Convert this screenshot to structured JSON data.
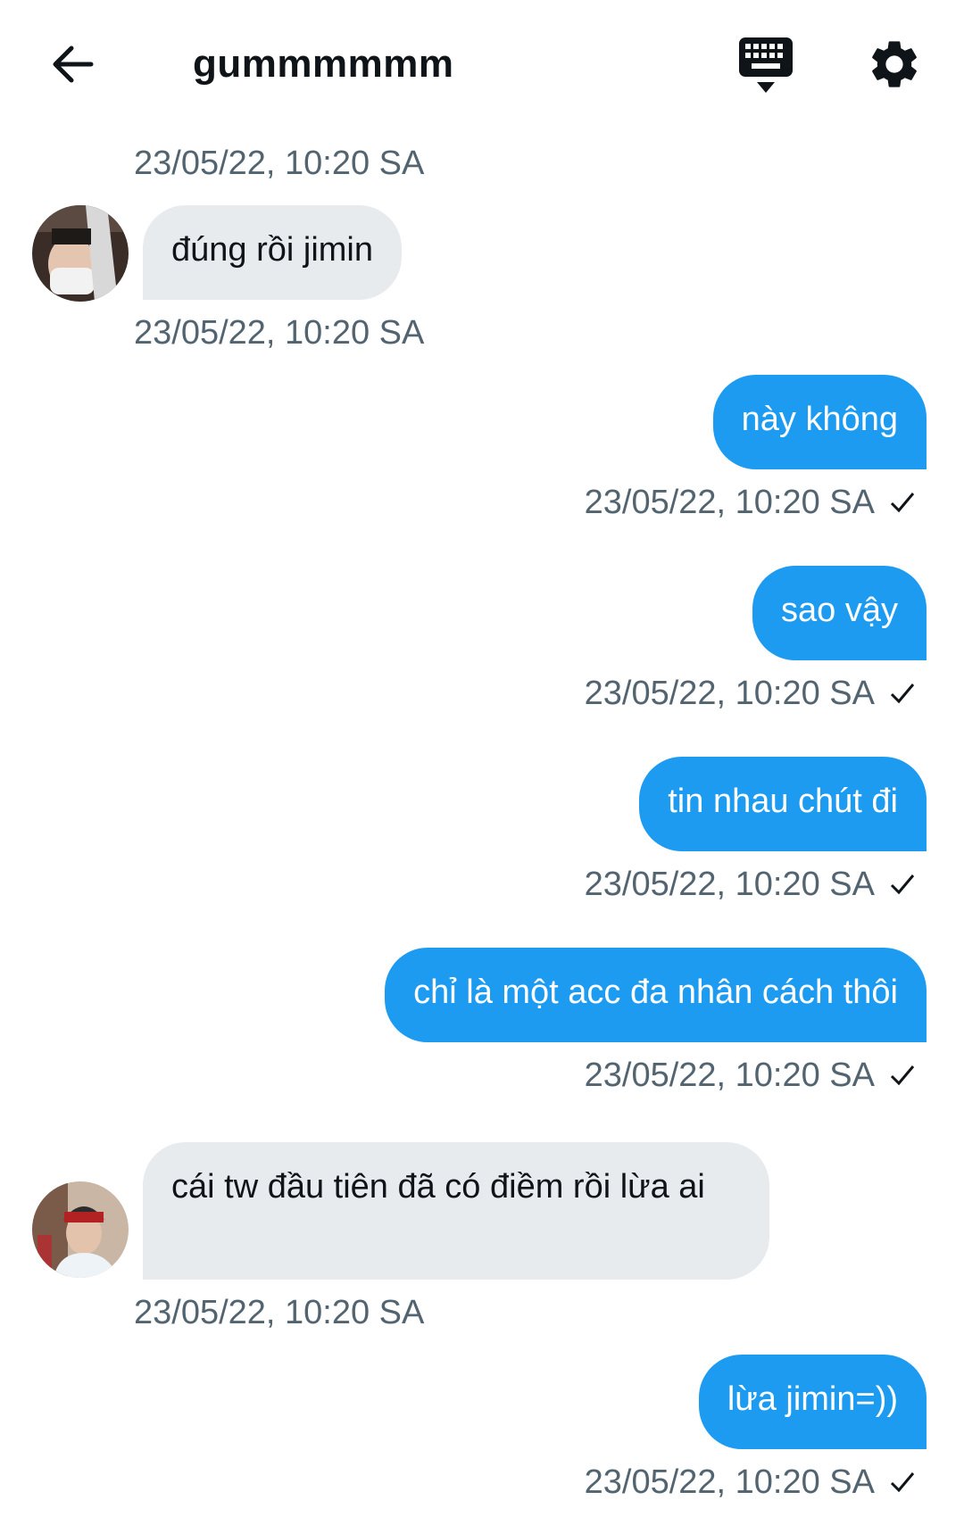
{
  "header": {
    "title": "gummmmmm",
    "back_icon": "arrow-left-icon",
    "keyboard_icon": "keyboard-icon",
    "settings_icon": "gear-icon"
  },
  "colors": {
    "sent_bubble": "#1d9bf0",
    "received_bubble": "#e8ebee",
    "timestamp": "#536471"
  },
  "messages": [
    {
      "direction": "received",
      "text": "",
      "timestamp": "23/05/22, 10:20 SA"
    },
    {
      "direction": "received",
      "text": "đúng rồi jimin",
      "timestamp": "23/05/22, 10:20 SA"
    },
    {
      "direction": "sent",
      "text": "này không",
      "timestamp": "23/05/22, 10:20 SA"
    },
    {
      "direction": "sent",
      "text": "sao vậy",
      "timestamp": "23/05/22, 10:20 SA"
    },
    {
      "direction": "sent",
      "text": "tin nhau chút đi",
      "timestamp": "23/05/22, 10:20 SA"
    },
    {
      "direction": "sent",
      "text": "chỉ là một acc đa nhân cách thôi",
      "timestamp": "23/05/22, 10:20 SA"
    },
    {
      "direction": "received",
      "text": "cái tw đầu tiên đã có điềm rồi lừa ai",
      "timestamp": "23/05/22, 10:20 SA"
    },
    {
      "direction": "sent",
      "text": "lừa jimin=))",
      "timestamp": "23/05/22, 10:20 SA"
    }
  ]
}
